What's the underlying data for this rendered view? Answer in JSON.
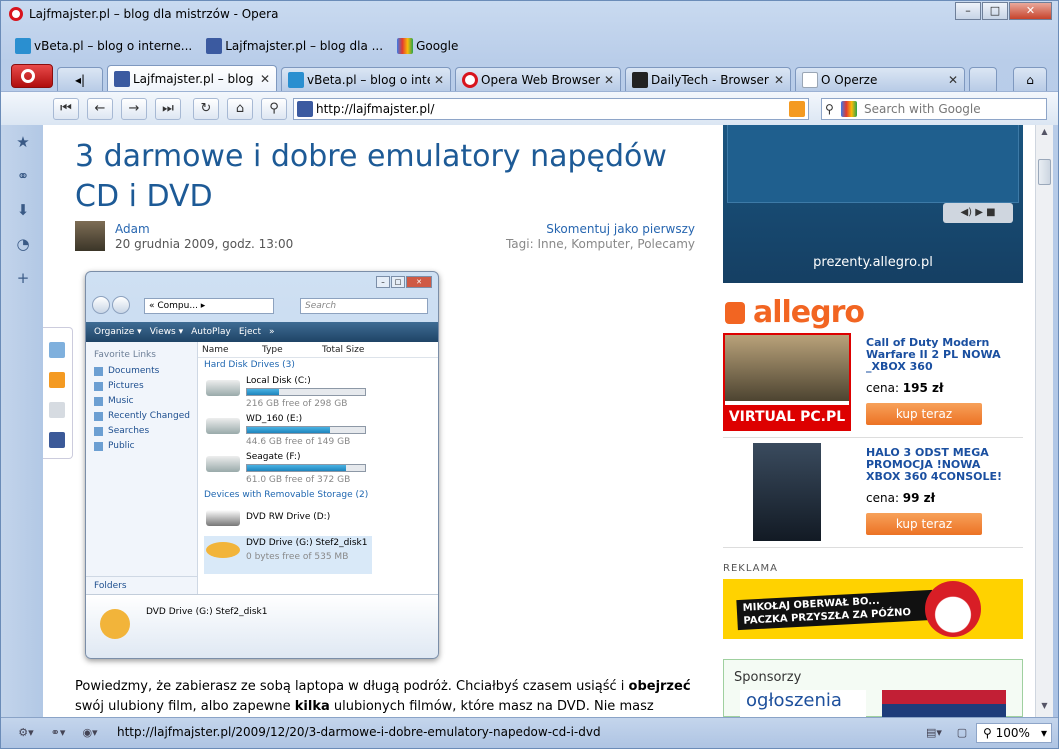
{
  "window": {
    "title": "Lajfmajster.pl – blog dla mistrzów - Opera"
  },
  "bookmarks": [
    {
      "label": "vBeta.pl – blog o interne...",
      "icon": "vbeta-favicon",
      "color": "#2a8fd0"
    },
    {
      "label": "Lajfmajster.pl – blog dla ...",
      "icon": "lajfmajster-favicon",
      "color": "#3b5aa0"
    },
    {
      "label": "Google",
      "icon": "google-favicon",
      "color": "#e33b2e"
    }
  ],
  "tabs": [
    {
      "label": "Lajfmajster.pl – blog ...",
      "active": true,
      "icon": "lajfmajster-favicon",
      "color": "#3b5aa0"
    },
    {
      "label": "vBeta.pl – blog o inter...",
      "active": false,
      "icon": "vbeta-favicon",
      "color": "#2a8fd0"
    },
    {
      "label": "Opera Web Browser | ...",
      "active": false,
      "icon": "opera-favicon",
      "color": "#d8141d"
    },
    {
      "label": "DailyTech - Browser ...",
      "active": false,
      "icon": "dailytech-favicon",
      "color": "#222222"
    },
    {
      "label": "O Operze",
      "active": false,
      "icon": "page-favicon",
      "color": "#9aa6b5"
    }
  ],
  "nav": {
    "url": "http://lajfmajster.pl/",
    "search_placeholder": "Search with Google"
  },
  "article": {
    "title": "3 darmowe i dobre emulatory napędów CD i DVD",
    "author": "Adam",
    "date": "20 grudnia 2009, godz. 13:00",
    "comments": "Skomentuj jako pierwszy",
    "tags": "Tagi: Inne, Komputer, Polecamy",
    "body_1": "Powiedzmy, że zabierasz ze sobą laptopa w długą podróż. Chciałbyś czasem usiąść i ",
    "body_b1": "obejrzeć",
    "body_2": " swój ulubiony film, albo zapewne ",
    "body_b2": "kilka",
    "body_3": " ulubionych filmów, które masz na DVD. Nie masz zamiaru"
  },
  "explorer": {
    "address": "« Compu... ▸",
    "search": "Search",
    "toolbar": [
      "Organize ▾",
      "Views ▾",
      "AutoPlay",
      "Eject",
      "»"
    ],
    "favorite_links_label": "Favorite Links",
    "favorites": [
      "Documents",
      "Pictures",
      "Music",
      "Recently Changed",
      "Searches",
      "Public"
    ],
    "folders_label": "Folders",
    "columns": [
      "Name",
      "Type",
      "Total Size"
    ],
    "group_hdd": "Hard Disk Drives (3)",
    "drives": [
      {
        "name": "Local Disk (C:)",
        "free": "216 GB free of 298 GB",
        "used_pct": 27
      },
      {
        "name": "WD_160 (E:)",
        "free": "44.6 GB free of 149 GB",
        "used_pct": 70
      },
      {
        "name": "Seagate (F:)",
        "free": "61.0 GB free of 372 GB",
        "used_pct": 84
      }
    ],
    "group_removable": "Devices with Removable Storage (2)",
    "removable": [
      {
        "name": "DVD RW Drive (D:)",
        "free": ""
      },
      {
        "name": "DVD Drive (G:) Stef2_disk1",
        "free": "0 bytes free of 535 MB"
      }
    ],
    "detail": "DVD Drive (G:) Stef2_disk1"
  },
  "sidebar": {
    "ad_top_text": "prezenty.allegro.pl",
    "allegro_logo": "allegro",
    "products": [
      {
        "name": "Call of Duty Modern Warfare II 2 PL NOWA _XBOX 360",
        "price_label": "cena: ",
        "price": "195 zł",
        "buy": "kup teraz",
        "badge": "VIRTUAL PC.PL"
      },
      {
        "name": "HALO 3 ODST MEGA PROMOCJA !NOWA XBOX 360 4CONSOLE!",
        "price_label": "cena: ",
        "price": "99 zł",
        "buy": "kup teraz",
        "badge": ""
      }
    ],
    "reklama_label": "REKLAMA",
    "reklama_banner_1": "MIKOŁAJ OBERWAŁ BO...",
    "reklama_banner_2": "PACZKA PRZYSZŁA ZA PÓŹNO",
    "sponsor_label": "Sponsorzy",
    "sponsor_1": "ogłoszenia"
  },
  "status": {
    "url": "http://lajfmajster.pl/2009/12/20/3-darmowe-i-dobre-emulatory-napedow-cd-i-dvd",
    "zoom": "100%"
  }
}
